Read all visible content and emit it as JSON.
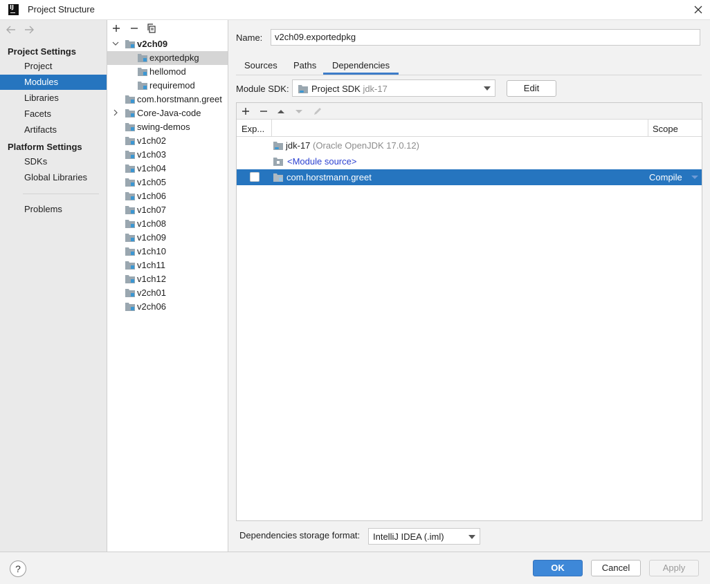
{
  "window": {
    "title": "Project Structure",
    "logo_text": "IJ"
  },
  "nav": {
    "sections": [
      {
        "title": "Project Settings",
        "items": [
          "Project",
          "Modules",
          "Libraries",
          "Facets",
          "Artifacts"
        ]
      },
      {
        "title": "Platform Settings",
        "items": [
          "SDKs",
          "Global Libraries"
        ]
      }
    ],
    "extra_items": [
      "Problems"
    ],
    "selected": "Modules"
  },
  "tree": {
    "items": [
      {
        "label": "v2ch09",
        "expanded": true,
        "bold": true
      },
      {
        "label": "exportedpkg",
        "selected": true
      },
      {
        "label": "hellomod"
      },
      {
        "label": "requiremod"
      },
      {
        "label": "com.horstmann.greet"
      },
      {
        "label": "Core-Java-code",
        "collapsed": true
      },
      {
        "label": "swing-demos"
      },
      {
        "label": "v1ch02"
      },
      {
        "label": "v1ch03"
      },
      {
        "label": "v1ch04"
      },
      {
        "label": "v1ch05"
      },
      {
        "label": "v1ch06"
      },
      {
        "label": "v1ch07"
      },
      {
        "label": "v1ch08"
      },
      {
        "label": "v1ch09"
      },
      {
        "label": "v1ch10"
      },
      {
        "label": "v1ch11"
      },
      {
        "label": "v1ch12"
      },
      {
        "label": "v2ch01"
      },
      {
        "label": "v2ch06"
      }
    ]
  },
  "detail": {
    "name_label": "Name:",
    "name_value": "v2ch09.exportedpkg",
    "tabs": [
      "Sources",
      "Paths",
      "Dependencies"
    ],
    "active_tab": "Dependencies",
    "sdk_label": "Module SDK:",
    "sdk_value": "Project SDK",
    "sdk_value_muted": "jdk-17",
    "edit_label": "Edit",
    "table": {
      "headers": {
        "export": "Exp...",
        "scope": "Scope"
      },
      "rows": [
        {
          "name": "jdk-17",
          "detail": "(Oracle OpenJDK 17.0.12)"
        },
        {
          "name": "<Module source>"
        },
        {
          "name": "com.horstmann.greet",
          "scope": "Compile",
          "exported": false
        }
      ]
    },
    "storage_label": "Dependencies storage format:",
    "storage_value": "IntelliJ IDEA (.iml)"
  },
  "footer": {
    "help": "?",
    "ok": "OK",
    "cancel": "Cancel",
    "apply": "Apply"
  },
  "colors": {
    "selection": "#2675bf",
    "ok_button": "#3e88d8",
    "tab_underline": "#3d7cc9"
  }
}
